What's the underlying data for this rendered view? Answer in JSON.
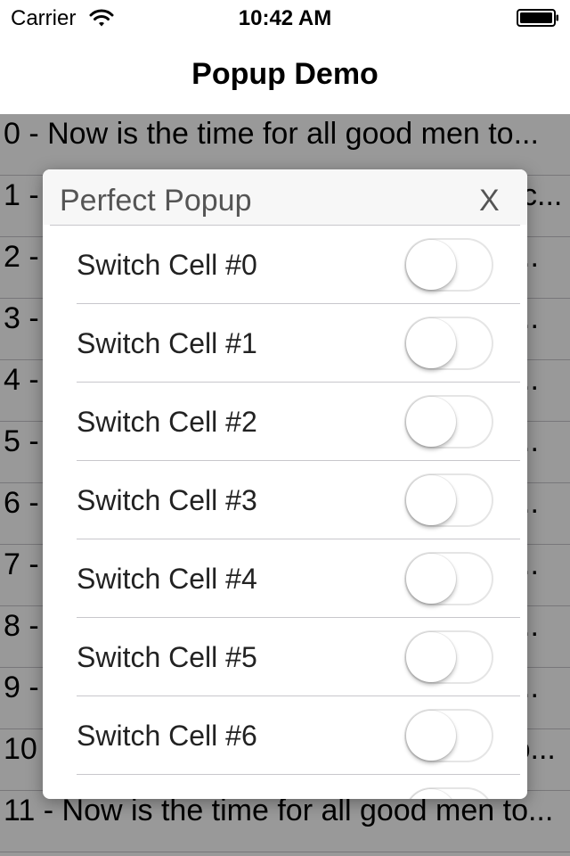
{
  "status_bar": {
    "carrier": "Carrier",
    "time": "10:42 AM"
  },
  "nav": {
    "title": "Popup Demo"
  },
  "rows": [
    "0 - Now is the time for all good men to...",
    "1 - Now is the time for all good men to c...",
    "2 - Now is the time for all good men to...",
    "3 - Now is the time for all good men to...",
    "4 - Now is the time for all good men to...",
    "5 - Now is the time for all good men to...",
    "6 - Now is the time for all good men to...",
    "7 - Now is the time for all good men to...",
    "8 - Now is the time for all good men to...",
    "9 - Now is the time for all good men to...",
    "10 - Now is the time for all good men to...",
    "11 - Now is the time for all good men to..."
  ],
  "popup": {
    "title": "Perfect Popup",
    "close_label": "X",
    "cells": [
      {
        "label": "Switch Cell #0",
        "on": false
      },
      {
        "label": "Switch Cell #1",
        "on": false
      },
      {
        "label": "Switch Cell #2",
        "on": false
      },
      {
        "label": "Switch Cell #3",
        "on": false
      },
      {
        "label": "Switch Cell #4",
        "on": false
      },
      {
        "label": "Switch Cell #5",
        "on": false
      },
      {
        "label": "Switch Cell #6",
        "on": false
      },
      {
        "label": "",
        "on": false
      }
    ]
  },
  "icons": {
    "wifi": "wifi-icon",
    "battery": "battery-icon"
  },
  "colors": {
    "overlay": "#000000",
    "separator": "#c8c7cc",
    "switch_off_border": "#e5e5e5"
  }
}
